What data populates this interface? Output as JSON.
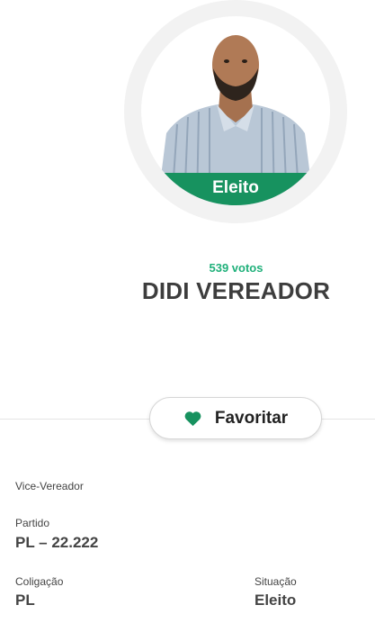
{
  "candidate": {
    "status_badge": "Eleito",
    "votes": "539 votos",
    "name": "DIDI VEREADOR"
  },
  "actions": {
    "favorite_label": "Favoritar",
    "favorite_icon": "heart-icon",
    "accent_color": "#17925f"
  },
  "details": {
    "role": "Vice-Vereador",
    "party_label": "Partido",
    "party_value": "PL – 22.222",
    "coalition_label": "Coligação",
    "coalition_value": "PL",
    "situation_label": "Situação",
    "situation_value": "Eleito"
  }
}
